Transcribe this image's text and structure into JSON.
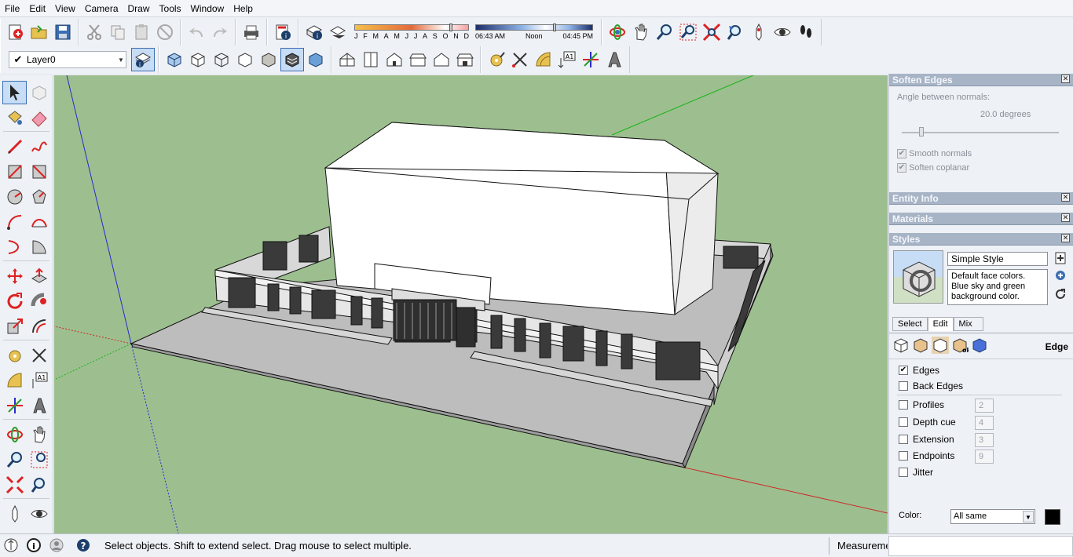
{
  "menu": [
    "File",
    "Edit",
    "View",
    "Camera",
    "Draw",
    "Tools",
    "Window",
    "Help"
  ],
  "layer": {
    "current": "Layer0"
  },
  "shadow": {
    "months": [
      "J",
      "F",
      "M",
      "A",
      "M",
      "J",
      "J",
      "A",
      "S",
      "O",
      "N",
      "D"
    ],
    "time_start": "06:43 AM",
    "time_noon": "Noon",
    "time_end": "04:45 PM"
  },
  "soften_edges": {
    "title": "Soften Edges",
    "angle_label": "Angle between normals:",
    "angle_value": "20.0  degrees",
    "smooth_normals": "Smooth normals",
    "soften_coplanar": "Soften coplanar",
    "smooth_checked": true,
    "coplanar_checked": true
  },
  "entity_info": {
    "title": "Entity Info"
  },
  "materials": {
    "title": "Materials"
  },
  "styles": {
    "title": "Styles",
    "style_name": "Simple Style",
    "description": "Default face colors. Blue sky and green background color.",
    "tabs": [
      "Select",
      "Edit",
      "Mix"
    ],
    "active_tab": "Edit",
    "section_label": "Edge",
    "edges": [
      {
        "label": "Edges",
        "checked": true,
        "value": null
      },
      {
        "label": "Back Edges",
        "checked": false,
        "value": null
      },
      {
        "label": "Profiles",
        "checked": false,
        "value": "2"
      },
      {
        "label": "Depth cue",
        "checked": false,
        "value": "4"
      },
      {
        "label": "Extension",
        "checked": false,
        "value": "3"
      },
      {
        "label": "Endpoints",
        "checked": false,
        "value": "9"
      },
      {
        "label": "Jitter",
        "checked": false,
        "value": null
      }
    ],
    "color_label": "Color:",
    "color_value": "All same",
    "color_swatch": "#000000"
  },
  "status": {
    "message": "Select objects. Shift to extend select. Drag mouse to select multiple.",
    "measurements_label": "Measureme"
  },
  "colors": {
    "background": "#9dbf8f",
    "tray_header": "#a7b4c6",
    "axis_red": "#cc2a2a",
    "axis_green": "#19b319",
    "axis_blue": "#2a2acc"
  }
}
